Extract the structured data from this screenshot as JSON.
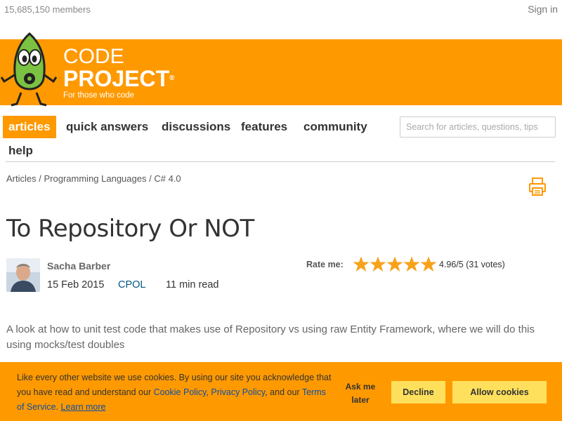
{
  "top_bar": {
    "members": "15,685,150 members",
    "sign_in": "Sign in"
  },
  "logo": {
    "code": "CODE",
    "project": "PROJECT",
    "registered": "®",
    "tagline": "For those who code"
  },
  "nav": {
    "items": [
      "articles",
      "quick answers",
      "discussions",
      "features",
      "community",
      "help"
    ],
    "active": "articles",
    "search_placeholder": "Search for articles, questions, tips"
  },
  "breadcrumb": {
    "items": [
      "Articles",
      "Programming Languages",
      "C# 4.0"
    ],
    "separator": "/"
  },
  "article": {
    "title": "To Repository Or NOT",
    "author": "Sacha Barber",
    "date": "15 Feb 2015",
    "license": "CPOL",
    "read_time": "11 min read",
    "summary": "A look at how to unit test code that makes use of Repository vs using raw Entity Framework, where we will do this using mocks/test doubles"
  },
  "rating": {
    "label": "Rate me:",
    "stars_filled": 5,
    "stars_total": 5,
    "text": "4.96/5 (31 votes)"
  },
  "cookie_banner": {
    "text_1": "Like every other website we use cookies. By using our site you acknowledge that you have read and understand our ",
    "cookie_policy": "Cookie Policy",
    "comma": ", ",
    "privacy_policy": "Privacy Policy",
    "and_our": ", and our ",
    "terms": "Terms of Service",
    "period": ". ",
    "learn_more": "Learn more",
    "ask_later": "Ask me later",
    "decline": "Decline",
    "allow": "Allow cookies"
  },
  "colors": {
    "brand_orange": "#ff9900",
    "button_yellow": "#ffe05c",
    "link_blue": "#0a4fa6",
    "star": "#f7a21b"
  }
}
